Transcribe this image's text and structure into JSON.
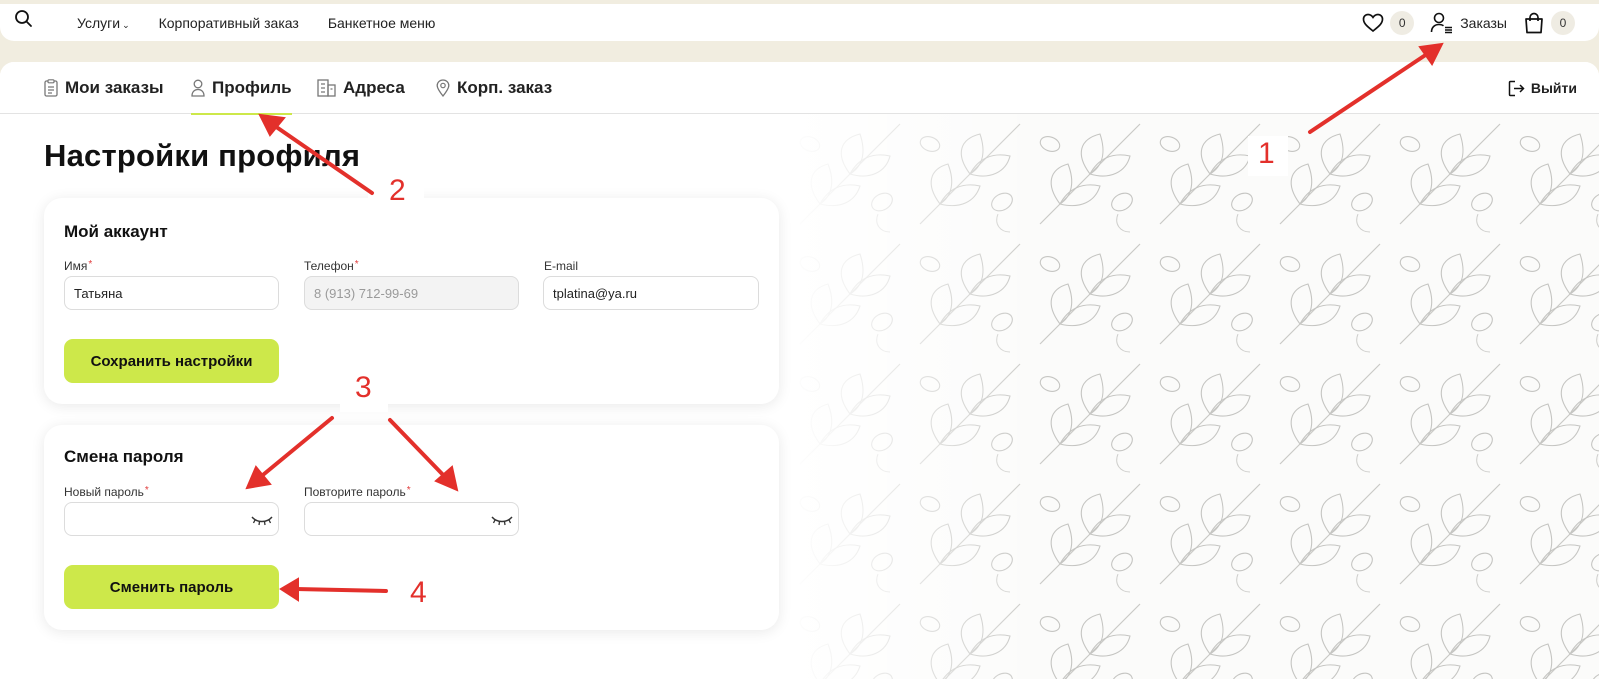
{
  "topbar": {
    "nav": [
      {
        "label": "Услуги",
        "has_dropdown": true
      },
      {
        "label": "Корпоративный заказ"
      },
      {
        "label": "Банкетное меню"
      }
    ],
    "favorites_count": "0",
    "orders_label": "Заказы",
    "cart_count": "0"
  },
  "tabs": [
    {
      "label": "Мои заказы",
      "icon": "clipboard-icon"
    },
    {
      "label": "Профиль",
      "icon": "user-icon",
      "active": true
    },
    {
      "label": "Адреса",
      "icon": "building-icon"
    },
    {
      "label": "Корп. заказ",
      "icon": "map-pin-icon"
    }
  ],
  "logout_label": "Выйти",
  "page_title": "Настройки профиля",
  "account": {
    "title": "Мой аккаунт",
    "name_label": "Имя",
    "name_value": "Татьяна",
    "phone_label": "Телефон",
    "phone_value": "8 (913) 712-99-69",
    "email_label": "E-mail",
    "email_value": "tplatina@ya.ru",
    "save_button": "Сохранить настройки"
  },
  "password": {
    "title": "Смена пароля",
    "new_label": "Новый пароль",
    "repeat_label": "Повторите пароль",
    "change_button": "Сменить пароль"
  },
  "required_mark": "*",
  "annotations": [
    "1",
    "2",
    "3",
    "4"
  ],
  "colors": {
    "accent": "#cde84a",
    "annotation": "#e3302b",
    "page_bg": "#f1ede0",
    "required": "#e03b3b"
  }
}
